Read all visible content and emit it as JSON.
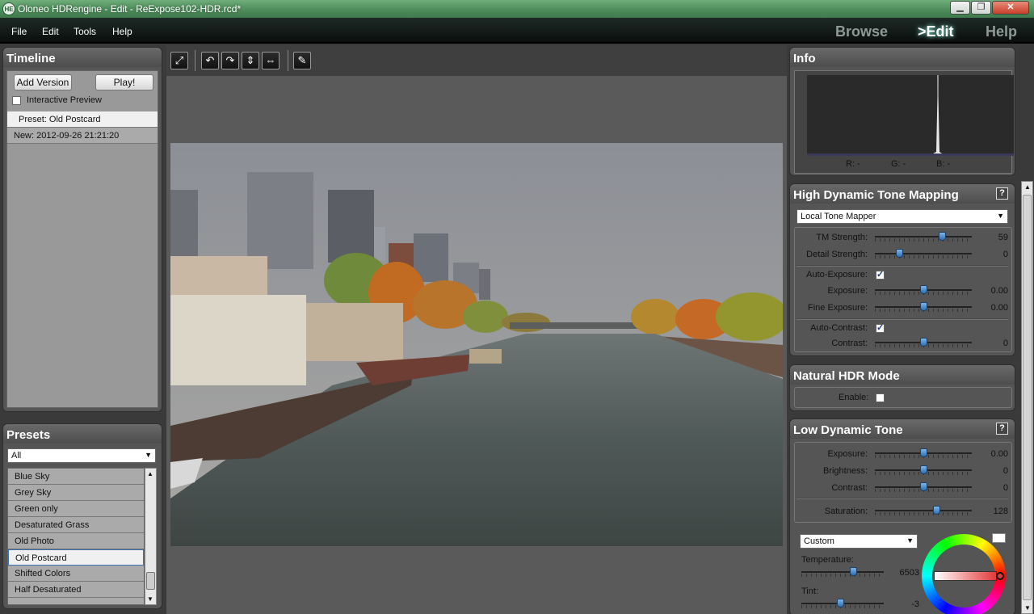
{
  "window": {
    "app_icon": "HE",
    "title": "Oloneo HDRengine - Edit - ReExpose102-HDR.rcd*",
    "minimize": "▁",
    "maximize": "❐",
    "close": "✕"
  },
  "menu": [
    "File",
    "Edit",
    "Tools",
    "Help"
  ],
  "modes": [
    {
      "label": "Browse",
      "active": false
    },
    {
      "label": ">Edit",
      "active": true
    },
    {
      "label": "Help",
      "active": false
    }
  ],
  "timeline": {
    "title": "Timeline",
    "add_version_label": "Add Version",
    "play_label": "Play!",
    "interactive_preview_label": "Interactive Preview",
    "interactive_preview_checked": false,
    "items": [
      "Preset: Old Postcard",
      "New: 2012-09-26 21:21:20"
    ]
  },
  "presets": {
    "title": "Presets",
    "filter": "All",
    "items": [
      "Blue Sky",
      "Grey Sky",
      "Green only",
      "Desaturated Grass",
      "Old Photo",
      "Old Postcard",
      "Shifted Colors",
      "Half Desaturated"
    ],
    "selected": "Old Postcard"
  },
  "info": {
    "title": "Info",
    "r_label": "R: -",
    "g_label": "G: -",
    "b_label": "B: -"
  },
  "hdtm": {
    "title": "High Dynamic Tone Mapping",
    "help": "?",
    "mapper": "Local Tone Mapper",
    "tm_strength": {
      "label": "TM Strength:",
      "value": "59",
      "pos": 0.69
    },
    "detail_strength": {
      "label": "Detail Strength:",
      "value": "0",
      "pos": 0.25
    },
    "auto_exposure": {
      "label": "Auto-Exposure:",
      "checked": true
    },
    "exposure": {
      "label": "Exposure:",
      "value": "0.00",
      "pos": 0.5
    },
    "fine_exposure": {
      "label": "Fine Exposure:",
      "value": "0.00",
      "pos": 0.5
    },
    "auto_contrast": {
      "label": "Auto-Contrast:",
      "checked": true
    },
    "contrast": {
      "label": "Contrast:",
      "value": "0",
      "pos": 0.5
    }
  },
  "natural_hdr": {
    "title": "Natural HDR Mode",
    "enable_label": "Enable:",
    "enabled": false
  },
  "ldt": {
    "title": "Low Dynamic Tone",
    "help": "?",
    "exposure": {
      "label": "Exposure:",
      "value": "0.00",
      "pos": 0.5
    },
    "brightness": {
      "label": "Brightness:",
      "value": "0",
      "pos": 0.5
    },
    "contrast": {
      "label": "Contrast:",
      "value": "0",
      "pos": 0.5
    },
    "saturation": {
      "label": "Saturation:",
      "value": "128",
      "pos": 0.63
    },
    "white_balance": "Custom",
    "temperature": {
      "label": "Temperature:",
      "value": "6503",
      "pos": 0.63
    },
    "tint": {
      "label": "Tint:",
      "value": "-3",
      "pos": 0.47
    }
  },
  "toolbar_icons": [
    "fit-to-window-icon",
    "rotate-left-icon",
    "rotate-right-icon",
    "flip-vertical-icon",
    "flip-horizontal-icon",
    "brush-icon"
  ]
}
